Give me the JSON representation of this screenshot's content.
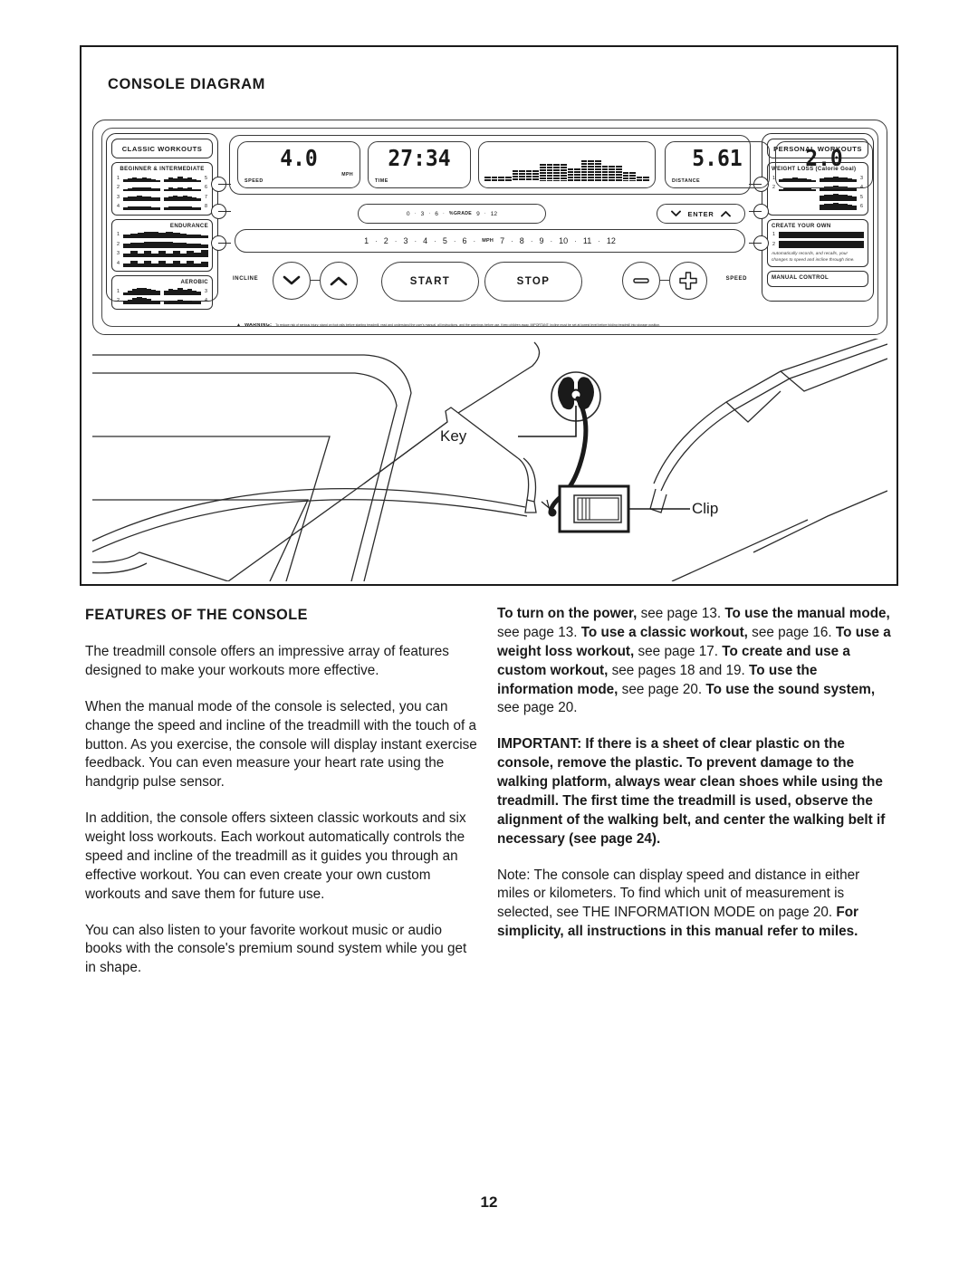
{
  "page": {
    "number": "12"
  },
  "diagram": {
    "title": "CONSOLE DIAGRAM",
    "key_label": "Key",
    "clip_label": "Clip"
  },
  "console": {
    "displays": [
      {
        "name": "speed",
        "value": "4.0",
        "caption": "SPEED",
        "unit": "MPH"
      },
      {
        "name": "time",
        "value": "27:34",
        "caption": "TIME",
        "unit": ""
      },
      {
        "name": "distance",
        "value": "5.61",
        "caption": "DISTANCE",
        "unit": ""
      },
      {
        "name": "incline",
        "value": "2.0",
        "caption": "INCLINE",
        "unit": ""
      }
    ],
    "matrix_heights": [
      14,
      14,
      14,
      14,
      34,
      34,
      34,
      34,
      52,
      52,
      52,
      52,
      38,
      38,
      64,
      64,
      64,
      48,
      48,
      48,
      28,
      28,
      14,
      14
    ],
    "grade_strip": {
      "unit": "%GRADE",
      "values": [
        "0",
        "3",
        "6",
        "9",
        "12"
      ]
    },
    "speed_strip": {
      "unit": "MPH",
      "values": [
        "1",
        "2",
        "3",
        "4",
        "5",
        "6",
        "7",
        "8",
        "9",
        "10",
        "11",
        "12"
      ]
    },
    "enter_button": "ENTER",
    "start_button": "START",
    "stop_button": "STOP",
    "incline_label": "INCLINE",
    "speed_label": "SPEED",
    "warning": {
      "symbol": "▲",
      "word": "WARNING:",
      "text": "To reduce risk of serious injury, stand on foot rails before starting treadmill, read and understand the user's manual, all instructions, and the warnings before use.  Keep children away.  IMPORTANT: Incline must be set at lowest level before folding treadmill into storage position."
    },
    "left_panel": {
      "heading": "CLASSIC WORKOUTS",
      "groups": [
        {
          "label": "BEGINNER & INTERMEDIATE",
          "label_align": "center",
          "layout": "two-column",
          "rows": [
            {
              "num": "1",
              "profile": [
                3,
                4,
                5,
                4,
                5,
                4,
                3,
                2
              ]
            },
            {
              "num": "2",
              "profile": [
                2,
                3,
                4,
                5,
                5,
                4,
                3,
                3
              ]
            },
            {
              "num": "3",
              "profile": [
                4,
                5,
                5,
                6,
                5,
                5,
                4,
                4
              ]
            },
            {
              "num": "4",
              "profile": [
                3,
                4,
                4,
                5,
                4,
                4,
                3,
                3
              ]
            }
          ],
          "rows_right": [
            {
              "num": "5",
              "profile": [
                3,
                5,
                4,
                6,
                4,
                5,
                3,
                2
              ]
            },
            {
              "num": "6",
              "profile": [
                2,
                4,
                3,
                5,
                3,
                4,
                2,
                2
              ]
            },
            {
              "num": "7",
              "profile": [
                4,
                5,
                6,
                5,
                6,
                5,
                4,
                3
              ]
            },
            {
              "num": "8",
              "profile": [
                3,
                4,
                5,
                4,
                5,
                4,
                3,
                3
              ]
            }
          ]
        },
        {
          "label": "ENDURANCE",
          "label_align": "right",
          "layout": "wide",
          "rows": [
            {
              "num": "1",
              "profile": [
                4,
                6,
                7,
                8,
                8,
                7,
                8,
                7,
                6,
                5,
                4,
                3
              ]
            },
            {
              "num": "2",
              "profile": [
                5,
                6,
                6,
                7,
                7,
                7,
                7,
                6,
                6,
                5,
                5,
                4
              ]
            },
            {
              "num": "3",
              "profile": [
                5,
                8,
                5,
                8,
                5,
                8,
                5,
                8,
                5,
                8,
                6,
                9
              ]
            },
            {
              "num": "4",
              "profile": [
                4,
                7,
                4,
                7,
                4,
                7,
                4,
                7,
                4,
                7,
                4,
                6
              ]
            }
          ]
        },
        {
          "label": "AEROBIC",
          "label_align": "right",
          "layout": "two-column",
          "rows": [
            {
              "num": "1",
              "profile": [
                3,
                5,
                7,
                8,
                8,
                7,
                6,
                5
              ]
            },
            {
              "num": "2",
              "profile": [
                4,
                6,
                8,
                9,
                8,
                7,
                5,
                4
              ]
            }
          ],
          "rows_right": [
            {
              "num": "3",
              "profile": [
                5,
                7,
                6,
                8,
                6,
                7,
                5,
                4
              ]
            },
            {
              "num": "4",
              "profile": [
                3,
                5,
                4,
                6,
                4,
                5,
                3,
                3
              ]
            }
          ]
        }
      ]
    },
    "right_panel": {
      "heading": "PERSONAL WORKOUTS",
      "groups": [
        {
          "label": "WEIGHT LOSS (Calorie Goal)",
          "label_align": "left",
          "layout": "two-column",
          "rows": [
            {
              "num": "1",
              "profile": [
                3,
                4,
                4,
                5,
                4,
                4,
                3,
                2
              ]
            },
            {
              "num": "2",
              "profile": [
                2,
                3,
                4,
                4,
                4,
                3,
                3,
                2
              ]
            }
          ],
          "rows_right": [
            {
              "num": "3",
              "profile": [
                4,
                5,
                5,
                6,
                5,
                5,
                4,
                3
              ]
            },
            {
              "num": "4",
              "profile": [
                5,
                6,
                6,
                7,
                6,
                6,
                5,
                4
              ]
            },
            {
              "num": "5",
              "profile": [
                6,
                7,
                7,
                8,
                7,
                7,
                6,
                5
              ]
            },
            {
              "num": "6",
              "profile": [
                7,
                8,
                8,
                9,
                8,
                8,
                7,
                6
              ]
            }
          ]
        },
        {
          "label": "CREATE YOUR OWN",
          "label_align": "left",
          "layout": "wide",
          "rows": [
            {
              "num": "1",
              "profile": [
                8,
                8,
                8,
                8,
                8,
                8,
                8,
                8,
                8,
                8,
                8,
                8
              ]
            },
            {
              "num": "2",
              "profile": [
                8,
                8,
                8,
                8,
                8,
                8,
                8,
                8,
                8,
                8,
                8,
                8
              ]
            }
          ],
          "note": "Automatically records, and recalls, your changes to speed and incline through time."
        },
        {
          "label": "MANUAL CONTROL",
          "label_align": "left",
          "layout": "none",
          "rows": []
        }
      ]
    }
  },
  "features": {
    "heading": "FEATURES OF THE CONSOLE",
    "paragraphs": [
      "The treadmill console offers an impressive array of features designed to make your workouts more effective.",
      "When the manual mode of the console is selected, you can change the speed and incline of the treadmill with the touch of a button. As you exercise, the console will display instant exercise feedback. You can even measure your heart rate using the handgrip pulse sensor.",
      "In addition, the console offers sixteen classic workouts and six weight loss workouts. Each workout automatically controls the speed and incline of the treadmill as it guides you through an effective workout. You can even create your own custom workouts and save them for future use.",
      "You can also listen to your favorite workout music or audio books with the console's premium sound system while you get in shape."
    ]
  },
  "instructions": {
    "references": [
      {
        "bold": "To turn on the power,",
        "plain": " see page 13. "
      },
      {
        "bold": "To use the manual mode,",
        "plain": " see page 13. "
      },
      {
        "bold": "To use a classic workout,",
        "plain": " see page 16. "
      },
      {
        "bold": "To use a weight loss workout,",
        "plain": " see page 17. "
      },
      {
        "bold": "To create and use a custom workout,",
        "plain": " see pages 18 and 19. "
      },
      {
        "bold": "To use the information mode,",
        "plain": " see page 20. "
      },
      {
        "bold": "To use the sound system,",
        "plain": " see page 20."
      }
    ],
    "important": "IMPORTANT: If there is a sheet of clear plastic on the console, remove the plastic. To prevent damage to the walking platform, always wear clean shoes while using the treadmill. The first time the treadmill is used, observe the alignment of the walking belt, and center the walking belt if necessary (see page 24).",
    "note_plain": "Note: The console can display speed and distance in either miles or kilometers. To find which unit of measurement is selected, see THE INFORMATION MODE on page 20. ",
    "note_bold": "For simplicity, all instructions in this manual refer to miles."
  }
}
